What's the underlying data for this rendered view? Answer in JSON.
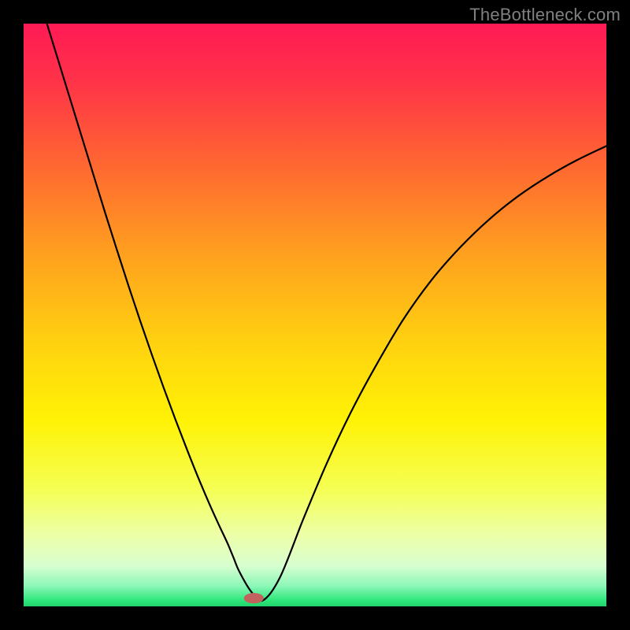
{
  "watermark": "TheBottleneck.com",
  "chart_data": {
    "type": "line",
    "title": "",
    "xlabel": "",
    "ylabel": "",
    "xlim": [
      0,
      1
    ],
    "ylim": [
      0,
      1
    ],
    "gradient_stops": [
      {
        "offset": 0.0,
        "color": "#ff1a55"
      },
      {
        "offset": 0.1,
        "color": "#ff3348"
      },
      {
        "offset": 0.25,
        "color": "#ff6a30"
      },
      {
        "offset": 0.4,
        "color": "#ffa21e"
      },
      {
        "offset": 0.55,
        "color": "#ffd210"
      },
      {
        "offset": 0.68,
        "color": "#fff205"
      },
      {
        "offset": 0.8,
        "color": "#f5ff55"
      },
      {
        "offset": 0.88,
        "color": "#ecffaa"
      },
      {
        "offset": 0.93,
        "color": "#d8ffd0"
      },
      {
        "offset": 0.965,
        "color": "#8cf7b8"
      },
      {
        "offset": 0.99,
        "color": "#2de67a"
      },
      {
        "offset": 1.0,
        "color": "#1fd36c"
      }
    ],
    "series": [
      {
        "name": "curve",
        "x": [
          0.04,
          0.06,
          0.08,
          0.1,
          0.12,
          0.14,
          0.16,
          0.18,
          0.2,
          0.22,
          0.24,
          0.26,
          0.28,
          0.3,
          0.32,
          0.335,
          0.35,
          0.36,
          0.37,
          0.39,
          0.41,
          0.44,
          0.48,
          0.52,
          0.56,
          0.6,
          0.65,
          0.7,
          0.75,
          0.8,
          0.85,
          0.9,
          0.95,
          1.0
        ],
        "y": [
          1.0,
          0.935,
          0.87,
          0.805,
          0.74,
          0.675,
          0.612,
          0.55,
          0.49,
          0.432,
          0.376,
          0.322,
          0.27,
          0.22,
          0.173,
          0.14,
          0.108,
          0.084,
          0.06,
          0.026,
          0.01,
          0.05,
          0.15,
          0.245,
          0.33,
          0.405,
          0.49,
          0.56,
          0.617,
          0.665,
          0.705,
          0.738,
          0.766,
          0.79
        ]
      }
    ],
    "marker": {
      "x": 0.395,
      "y": 0.014,
      "rx": 0.017,
      "ry": 0.009,
      "color": "#c1625e"
    }
  }
}
